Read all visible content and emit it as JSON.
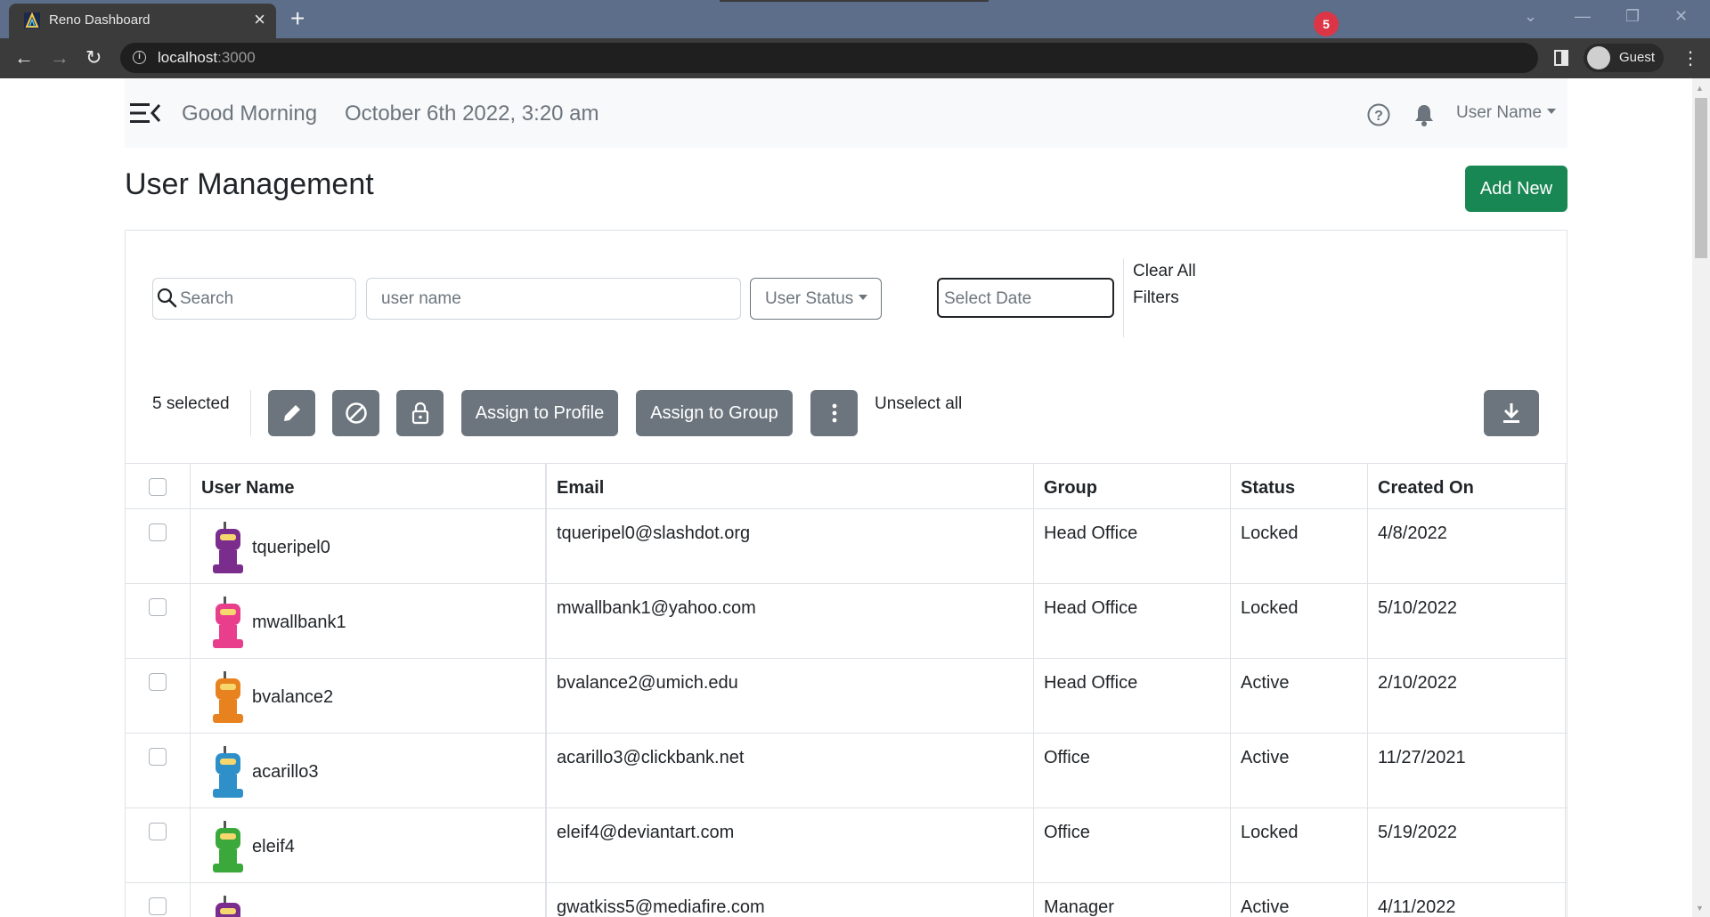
{
  "browser": {
    "tab_title": "Reno Dashboard",
    "url_host": "localhost",
    "url_port": ":3000",
    "profile_label": "Guest"
  },
  "header": {
    "greeting": "Good Morning",
    "datetime": "October 6th 2022, 3:20 am",
    "notification_count": "5",
    "user_name": "User Name"
  },
  "page": {
    "title": "User Management",
    "add_new_label": "Add New"
  },
  "filters": {
    "search_placeholder": "Search",
    "username_placeholder": "user name",
    "status_label": "User Status",
    "date_placeholder": "Select Date",
    "clear_label": "Clear All Filters"
  },
  "toolbar": {
    "selected_text": "5 selected",
    "assign_profile_label": "Assign to Profile",
    "assign_group_label": "Assign to Group",
    "unselect_label": "Unselect all"
  },
  "table": {
    "columns": [
      "User Name",
      "Email",
      "Group",
      "Status",
      "Created On"
    ],
    "rows": [
      {
        "username": "tqueripel0",
        "email": "tqueripel0@slashdot.org",
        "group": "Head Office",
        "status": "Locked",
        "created": "4/8/2022",
        "avatar_color": "#7b2d8e"
      },
      {
        "username": "mwallbank1",
        "email": "mwallbank1@yahoo.com",
        "group": "Head Office",
        "status": "Locked",
        "created": "5/10/2022",
        "avatar_color": "#e83e8c"
      },
      {
        "username": "bvalance2",
        "email": "bvalance2@umich.edu",
        "group": "Head Office",
        "status": "Active",
        "created": "2/10/2022",
        "avatar_color": "#e8821e"
      },
      {
        "username": "acarillo3",
        "email": "acarillo3@clickbank.net",
        "group": "Office",
        "status": "Active",
        "created": "11/27/2021",
        "avatar_color": "#2f8fc9"
      },
      {
        "username": "eleif4",
        "email": "eleif4@deviantart.com",
        "group": "Office",
        "status": "Locked",
        "created": "5/19/2022",
        "avatar_color": "#3aa83a"
      },
      {
        "username": "",
        "email": "gwatkiss5@mediafire.com",
        "group": "Manager",
        "status": "Active",
        "created": "4/11/2022",
        "avatar_color": "#7b2d8e"
      }
    ]
  },
  "colors": {
    "primary_green": "#198754",
    "secondary_gray": "#6c757d",
    "danger_red": "#dc3545"
  }
}
